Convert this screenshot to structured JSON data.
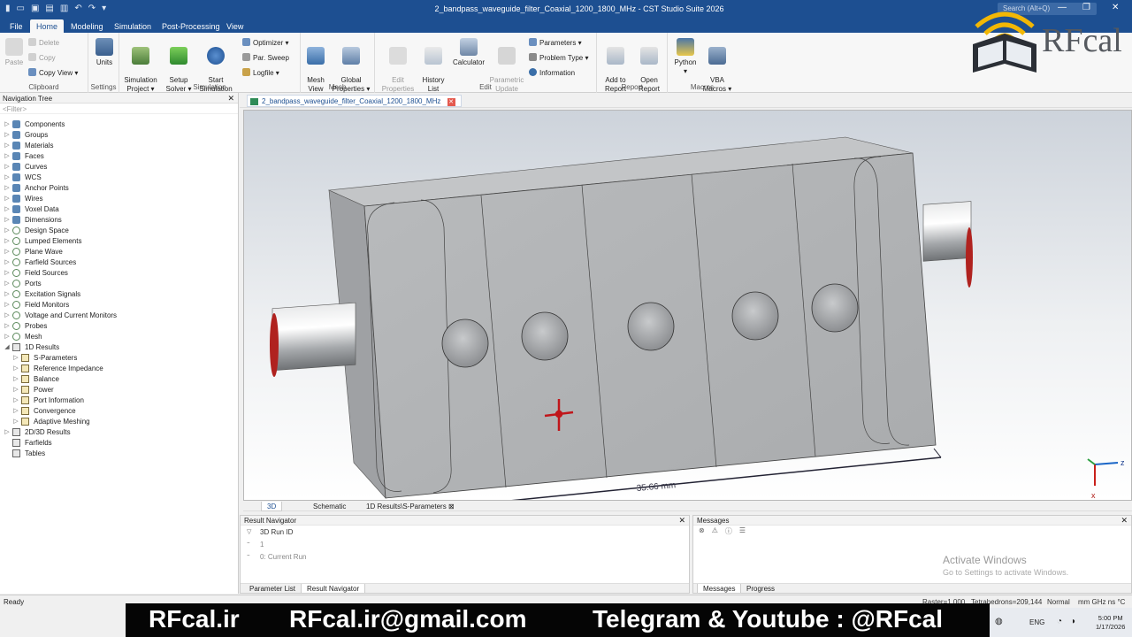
{
  "window": {
    "title": "2_bandpass_waveguide_filter_Coaxial_1200_1800_MHz - CST Studio Suite 2026",
    "search_placeholder": "Search (Alt+Q)"
  },
  "menu": {
    "tabs": [
      "File",
      "Home",
      "Modeling",
      "Simulation",
      "Post-Processing",
      "View"
    ],
    "active": "Home"
  },
  "ribbon": {
    "clipboard": {
      "label": "Clipboard",
      "paste": "Paste",
      "delete": "Delete",
      "copy": "Copy",
      "copy_view": "Copy View"
    },
    "settings": {
      "label": "Settings",
      "units": "Units"
    },
    "simulation": {
      "label": "Simulation",
      "sim_project": "Simulation\nProject",
      "setup_solver": "Setup\nSolver",
      "start_sim": "Start\nSimulation",
      "optimizer": "Optimizer",
      "par_sweep": "Par. Sweep",
      "logfile": "Logfile"
    },
    "mesh": {
      "label": "Mesh",
      "mesh_view": "Mesh\nView",
      "global_props": "Global\nProperties"
    },
    "edit": {
      "label": "Edit",
      "edit_props": "Edit\nProperties",
      "history_list": "History\nList",
      "calculator": "Calculator",
      "param_update": "Parametric\nUpdate",
      "parameters": "Parameters",
      "problem_type": "Problem Type",
      "information": "Information"
    },
    "report": {
      "label": "Report",
      "add_to_report": "Add to\nReport",
      "open_report": "Open\nReport"
    },
    "macros": {
      "label": "Macros",
      "python": "Python",
      "vba": "VBA\nMacros"
    }
  },
  "nav": {
    "title": "Navigation Tree",
    "filter": "<Filter>",
    "items": [
      {
        "label": "Components",
        "icon": "cube",
        "level": 0
      },
      {
        "label": "Groups",
        "icon": "cube",
        "level": 0
      },
      {
        "label": "Materials",
        "icon": "cube",
        "level": 0
      },
      {
        "label": "Faces",
        "icon": "cube",
        "level": 0
      },
      {
        "label": "Curves",
        "icon": "cube",
        "level": 0
      },
      {
        "label": "WCS",
        "icon": "cube",
        "level": 0
      },
      {
        "label": "Anchor Points",
        "icon": "cube",
        "level": 0
      },
      {
        "label": "Wires",
        "icon": "cube",
        "level": 0
      },
      {
        "label": "Voxel Data",
        "icon": "cube",
        "level": 0
      },
      {
        "label": "Dimensions",
        "icon": "cube",
        "level": 0
      },
      {
        "label": "Design Space",
        "icon": "ring",
        "level": 0
      },
      {
        "label": "Lumped Elements",
        "icon": "ring",
        "level": 0
      },
      {
        "label": "Plane Wave",
        "icon": "ring",
        "level": 0
      },
      {
        "label": "Farfield Sources",
        "icon": "ring",
        "level": 0
      },
      {
        "label": "Field Sources",
        "icon": "ring",
        "level": 0
      },
      {
        "label": "Ports",
        "icon": "ring",
        "level": 0
      },
      {
        "label": "Excitation Signals",
        "icon": "ring",
        "level": 0
      },
      {
        "label": "Field Monitors",
        "icon": "ring",
        "level": 0
      },
      {
        "label": "Voltage and Current Monitors",
        "icon": "ring",
        "level": 0
      },
      {
        "label": "Probes",
        "icon": "ring",
        "level": 0
      },
      {
        "label": "Mesh",
        "icon": "ring",
        "level": 0
      },
      {
        "label": "1D Results",
        "icon": "tab2",
        "level": 0,
        "expanded": true
      },
      {
        "label": "S-Parameters",
        "icon": "fold",
        "level": 1
      },
      {
        "label": "Reference Impedance",
        "icon": "fold",
        "level": 1
      },
      {
        "label": "Balance",
        "icon": "fold",
        "level": 1
      },
      {
        "label": "Power",
        "icon": "fold",
        "level": 1
      },
      {
        "label": "Port Information",
        "icon": "fold",
        "level": 1
      },
      {
        "label": "Convergence",
        "icon": "fold",
        "level": 1
      },
      {
        "label": "Adaptive Meshing",
        "icon": "fold",
        "level": 1
      },
      {
        "label": "2D/3D Results",
        "icon": "tab2",
        "level": 0
      },
      {
        "label": "Farfields",
        "icon": "tab2",
        "level": 0,
        "noarrow": true
      },
      {
        "label": "Tables",
        "icon": "tab2",
        "level": 0,
        "noarrow": true
      }
    ]
  },
  "doc_tab": "2_bandpass_waveguide_filter_Coaxial_1200_1800_MHz",
  "viewport": {
    "dimension_label": "35.66 mm",
    "axis_x": "x",
    "axis_z": "z"
  },
  "view_tabs": [
    "3D",
    "Schematic",
    "1D Results\\S-Parameters"
  ],
  "result_navigator": {
    "title": "Result Navigator",
    "rows": [
      "3D Run ID",
      "1",
      "0: Current Run"
    ],
    "tabs": [
      "Parameter List",
      "Result Navigator"
    ]
  },
  "messages": {
    "title": "Messages",
    "tabs": [
      "Messages",
      "Progress"
    ],
    "activate_title": "Activate Windows",
    "activate_sub": "Go to Settings to activate Windows."
  },
  "status": {
    "ready": "Ready",
    "raster": "Raster=1.000",
    "tets": "Tetrahedrons=209,144",
    "mode": "Normal",
    "units": "mm  GHz  ns  °C"
  },
  "banner": {
    "site": "RFcal.ir",
    "email": "RFcal.ir@gmail.com",
    "social": "Telegram & Youtube : @RFcal"
  },
  "logo": {
    "text": "RFcal"
  },
  "taskbar": {
    "lang": "ENG",
    "time": "5:00 PM",
    "date": "1/17/2026"
  }
}
